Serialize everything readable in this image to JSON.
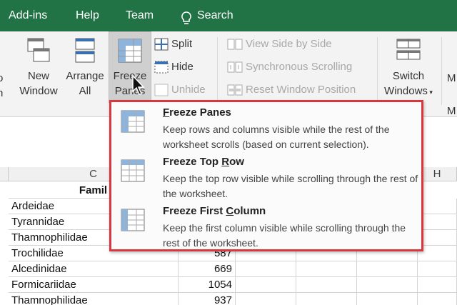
{
  "tabs": [
    "Add-ins",
    "Help",
    "Team"
  ],
  "search_label": "Search",
  "ribbon": {
    "new_window": [
      "New",
      "Window"
    ],
    "arrange_all": [
      "Arrange",
      "All"
    ],
    "freeze_panes": [
      "Freeze",
      "Panes"
    ],
    "split": "Split",
    "hide": "Hide",
    "unhide": "Unhide",
    "view_side_by_side": "View Side by Side",
    "synchronous_scrolling": "Synchronous Scrolling",
    "reset_window_position": "Reset Window Position",
    "switch_windows": [
      "Switch",
      "Windows"
    ],
    "left_edge": [
      "o",
      "n"
    ],
    "right_edge": [
      "M",
      "M"
    ]
  },
  "menu": {
    "items": [
      {
        "title_pre": "",
        "title_u": "F",
        "title_post": "reeze Panes",
        "desc": "Keep rows and columns visible while the rest of the worksheet scrolls (based on current selection).",
        "icon": "freeze-panes-icon"
      },
      {
        "title_pre": "Freeze Top ",
        "title_u": "R",
        "title_post": "ow",
        "desc": "Keep the top row visible while scrolling through the rest of the worksheet.",
        "icon": "freeze-top-row-icon"
      },
      {
        "title_pre": "Freeze First ",
        "title_u": "C",
        "title_post": "olumn",
        "desc": "Keep the first column visible while scrolling through the rest of the worksheet.",
        "icon": "freeze-first-column-icon"
      }
    ]
  },
  "sheet": {
    "col_c": "C",
    "col_h": "H",
    "header": "Famil",
    "rows": [
      {
        "family": "Ardeidae",
        "count": ""
      },
      {
        "family": "Tyrannidae",
        "count": ""
      },
      {
        "family": "Thamnophilidae",
        "count": ""
      },
      {
        "family": "Trochilidae",
        "count": "587"
      },
      {
        "family": "Alcedinidae",
        "count": "669"
      },
      {
        "family": "Formicariidae",
        "count": "1054"
      },
      {
        "family": "Thamnophilidae",
        "count": "937"
      }
    ]
  },
  "colors": {
    "accent": "#217346",
    "highlight": "#d9373f"
  }
}
